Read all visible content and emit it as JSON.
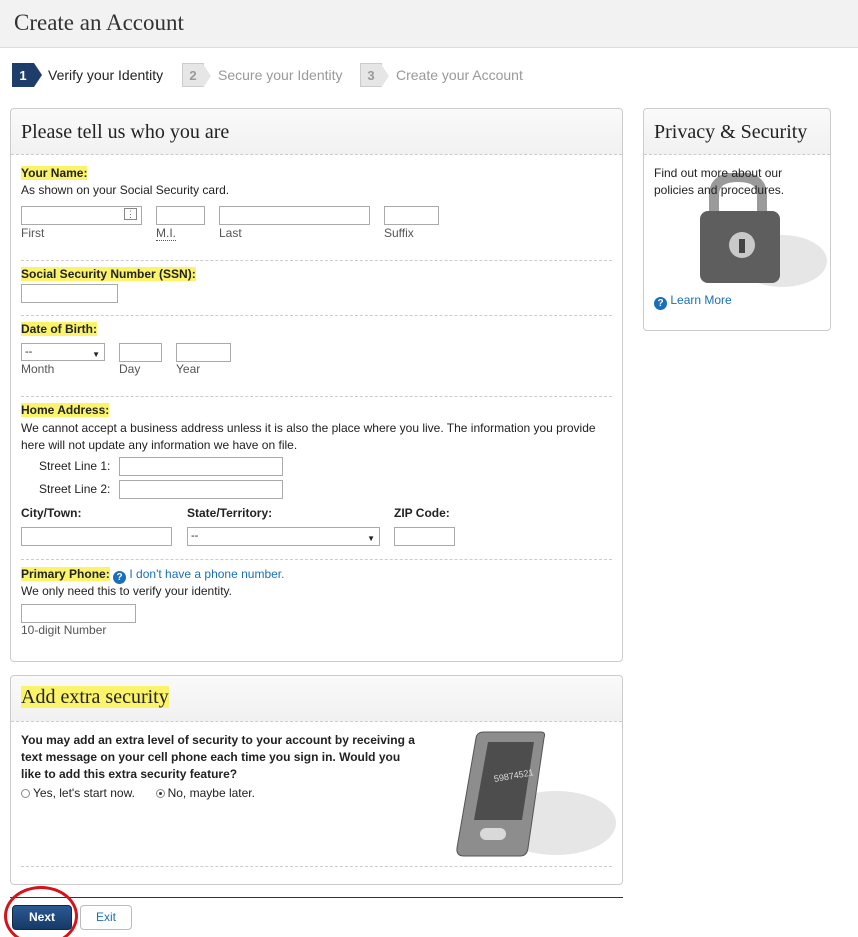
{
  "header": {
    "title": "Create an Account"
  },
  "steps": [
    {
      "num": "1",
      "label": "Verify your Identity"
    },
    {
      "num": "2",
      "label": "Secure your Identity"
    },
    {
      "num": "3",
      "label": "Create your Account"
    }
  ],
  "main_panel": {
    "title": "Please tell us who you are",
    "name": {
      "label": "Your Name:",
      "help": "As shown on your Social Security card.",
      "first": "First",
      "mi": "M.I.",
      "last": "Last",
      "suffix": "Suffix"
    },
    "ssn": {
      "label": "Social Security Number (SSN):"
    },
    "dob": {
      "label": "Date of Birth:",
      "month_value": "--",
      "month": "Month",
      "day": "Day",
      "year": "Year"
    },
    "address": {
      "label": "Home Address:",
      "help": "We cannot accept a business address unless it is also the place where you live. The information you provide here will not update any information we have on file.",
      "street1": "Street Line 1:",
      "street2": "Street Line 2:",
      "city": "City/Town:",
      "state": "State/Territory:",
      "state_value": "--",
      "zip": "ZIP Code:"
    },
    "phone": {
      "label": "Primary Phone:",
      "no_phone_link": "I don't have a phone number.",
      "help": "We only need this to verify your identity.",
      "hint": "10-digit Number"
    }
  },
  "security_panel": {
    "title": "Add extra security",
    "text": "You may add an extra level of security to your account by receiving a text message on your cell phone each time you sign in. Would you like to add this extra security feature?",
    "option_yes": "Yes, let's start now.",
    "option_no": "No, maybe later.",
    "selected": "no",
    "phone_screen_code": "59874521"
  },
  "privacy_panel": {
    "title": "Privacy & Security",
    "text": "Find out more about our policies and procedures.",
    "learn_more": "Learn More"
  },
  "buttons": {
    "next": "Next",
    "exit": "Exit"
  },
  "colors": {
    "highlight": "#fbf36a",
    "accent": "#1f3d6b",
    "link": "#1a6fb8",
    "annotation": "#d4141a"
  }
}
